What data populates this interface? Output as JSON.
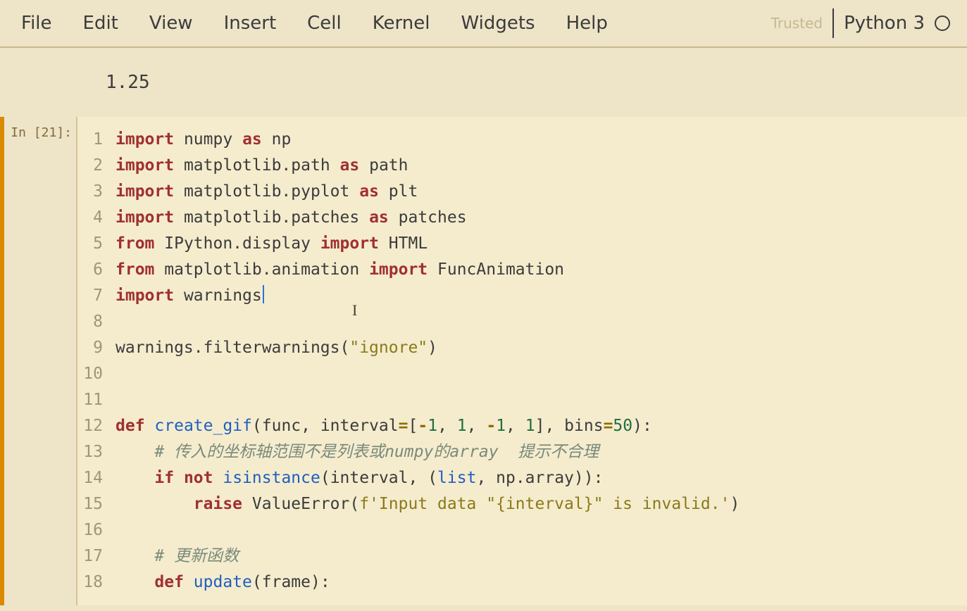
{
  "menubar": {
    "items": [
      "File",
      "Edit",
      "View",
      "Insert",
      "Cell",
      "Kernel",
      "Widgets",
      "Help"
    ],
    "trusted": "Trusted",
    "kernel": "Python 3"
  },
  "pre_output": "1.25",
  "cell": {
    "prompt": "In [21]:",
    "lines": [
      {
        "n": 1,
        "tokens": [
          [
            "kw",
            "import"
          ],
          [
            "sp",
            " "
          ],
          [
            "id",
            "numpy"
          ],
          [
            "sp",
            " "
          ],
          [
            "kw",
            "as"
          ],
          [
            "sp",
            " "
          ],
          [
            "id",
            "np"
          ]
        ]
      },
      {
        "n": 2,
        "tokens": [
          [
            "kw",
            "import"
          ],
          [
            "sp",
            " "
          ],
          [
            "id",
            "matplotlib.path"
          ],
          [
            "sp",
            " "
          ],
          [
            "kw",
            "as"
          ],
          [
            "sp",
            " "
          ],
          [
            "id",
            "path"
          ]
        ]
      },
      {
        "n": 3,
        "tokens": [
          [
            "kw",
            "import"
          ],
          [
            "sp",
            " "
          ],
          [
            "id",
            "matplotlib.pyplot"
          ],
          [
            "sp",
            " "
          ],
          [
            "kw",
            "as"
          ],
          [
            "sp",
            " "
          ],
          [
            "id",
            "plt"
          ]
        ]
      },
      {
        "n": 4,
        "tokens": [
          [
            "kw",
            "import"
          ],
          [
            "sp",
            " "
          ],
          [
            "id",
            "matplotlib.patches"
          ],
          [
            "sp",
            " "
          ],
          [
            "kw",
            "as"
          ],
          [
            "sp",
            " "
          ],
          [
            "id",
            "patches"
          ]
        ]
      },
      {
        "n": 5,
        "tokens": [
          [
            "kw",
            "from"
          ],
          [
            "sp",
            " "
          ],
          [
            "id",
            "IPython.display"
          ],
          [
            "sp",
            " "
          ],
          [
            "kw",
            "import"
          ],
          [
            "sp",
            " "
          ],
          [
            "id",
            "HTML"
          ]
        ]
      },
      {
        "n": 6,
        "tokens": [
          [
            "kw",
            "from"
          ],
          [
            "sp",
            " "
          ],
          [
            "id",
            "matplotlib.animation"
          ],
          [
            "sp",
            " "
          ],
          [
            "kw",
            "import"
          ],
          [
            "sp",
            " "
          ],
          [
            "id",
            "FuncAnimation"
          ]
        ]
      },
      {
        "n": 7,
        "tokens": [
          [
            "kw",
            "import"
          ],
          [
            "sp",
            " "
          ],
          [
            "id",
            "warnings"
          ]
        ],
        "caret_after": true
      },
      {
        "n": 8,
        "tokens": []
      },
      {
        "n": 9,
        "tokens": [
          [
            "id",
            "warnings.filterwarnings"
          ],
          [
            "paren",
            "("
          ],
          [
            "str",
            "\"ignore\""
          ],
          [
            "paren",
            ")"
          ]
        ]
      },
      {
        "n": 10,
        "tokens": []
      },
      {
        "n": 11,
        "tokens": []
      },
      {
        "n": 12,
        "tokens": [
          [
            "kw",
            "def"
          ],
          [
            "sp",
            " "
          ],
          [
            "def",
            "create_gif"
          ],
          [
            "paren",
            "("
          ],
          [
            "id",
            "func, interval"
          ],
          [
            "op",
            "="
          ],
          [
            "paren",
            "["
          ],
          [
            "op",
            "-"
          ],
          [
            "num",
            "1"
          ],
          [
            "id",
            ", "
          ],
          [
            "num",
            "1"
          ],
          [
            "id",
            ", "
          ],
          [
            "op",
            "-"
          ],
          [
            "num",
            "1"
          ],
          [
            "id",
            ", "
          ],
          [
            "num",
            "1"
          ],
          [
            "paren",
            "]"
          ],
          [
            "id",
            ", bins"
          ],
          [
            "op",
            "="
          ],
          [
            "num",
            "50"
          ],
          [
            "paren",
            ")"
          ],
          [
            "id",
            ":"
          ]
        ]
      },
      {
        "n": 13,
        "tokens": [
          [
            "sp",
            "    "
          ],
          [
            "comment",
            "# 传入的坐标轴范围不是列表或numpy的array  提示不合理"
          ]
        ]
      },
      {
        "n": 14,
        "tokens": [
          [
            "sp",
            "    "
          ],
          [
            "kw",
            "if"
          ],
          [
            "sp",
            " "
          ],
          [
            "kw",
            "not"
          ],
          [
            "sp",
            " "
          ],
          [
            "builtin",
            "isinstance"
          ],
          [
            "paren",
            "("
          ],
          [
            "id",
            "interval, "
          ],
          [
            "paren",
            "("
          ],
          [
            "builtin",
            "list"
          ],
          [
            "id",
            ", np.array"
          ],
          [
            "paren",
            "))"
          ],
          [
            "id",
            ":"
          ]
        ]
      },
      {
        "n": 15,
        "tokens": [
          [
            "sp",
            "        "
          ],
          [
            "kw",
            "raise"
          ],
          [
            "sp",
            " "
          ],
          [
            "id",
            "ValueError"
          ],
          [
            "paren",
            "("
          ],
          [
            "str",
            "f'Input data \"{interval}\" is invalid.'"
          ],
          [
            "paren",
            ")"
          ]
        ]
      },
      {
        "n": 16,
        "tokens": []
      },
      {
        "n": 17,
        "tokens": [
          [
            "sp",
            "    "
          ],
          [
            "comment",
            "# 更新函数"
          ]
        ]
      },
      {
        "n": 18,
        "tokens": [
          [
            "sp",
            "    "
          ],
          [
            "kw",
            "def"
          ],
          [
            "sp",
            " "
          ],
          [
            "def",
            "update"
          ],
          [
            "paren",
            "("
          ],
          [
            "id",
            "frame"
          ],
          [
            "paren",
            ")"
          ],
          [
            "id",
            ":"
          ]
        ]
      }
    ]
  }
}
